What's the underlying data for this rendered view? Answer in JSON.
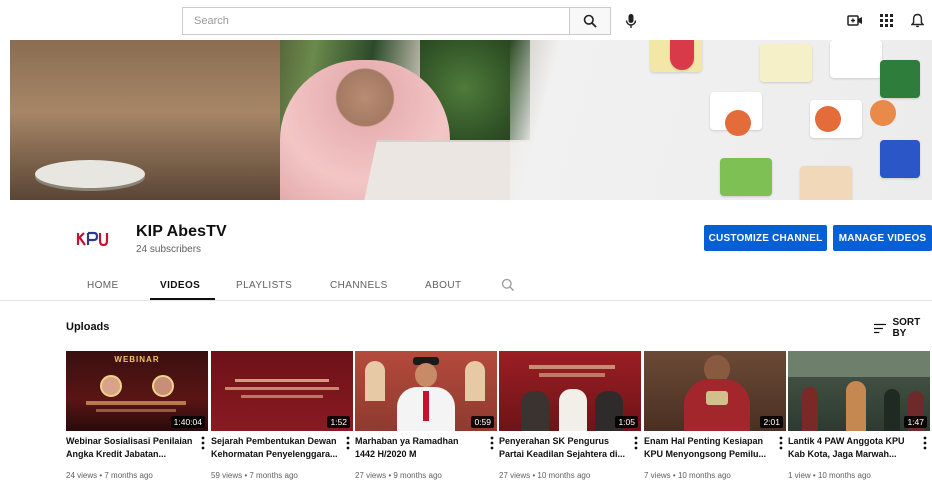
{
  "search": {
    "placeholder": "Search"
  },
  "channel": {
    "name": "KIP AbesTV",
    "subscribers": "24 subscribers",
    "logo_text": "KPU",
    "customize_label": "CUSTOMIZE CHANNEL",
    "manage_label": "MANAGE VIDEOS"
  },
  "tabs": [
    {
      "label": "HOME",
      "active": false
    },
    {
      "label": "VIDEOS",
      "active": true
    },
    {
      "label": "PLAYLISTS",
      "active": false
    },
    {
      "label": "CHANNELS",
      "active": false
    },
    {
      "label": "ABOUT",
      "active": false
    }
  ],
  "uploads": {
    "title": "Uploads",
    "sort_label": "SORT BY"
  },
  "videos": [
    {
      "title": "Webinar Sosialisasi Penilaian\nAngka Kredit Jabatan...",
      "views": "24 views",
      "age": "7 months ago",
      "duration": "1:40:04",
      "thumb_text": "WEBINAR"
    },
    {
      "title": "Sejarah Pembentukan Dewan\nKehormatan Penyelenggara...",
      "views": "59 views",
      "age": "7 months ago",
      "duration": "1:52",
      "thumb_text": ""
    },
    {
      "title": "Marhaban ya Ramadhan\n1442 H/2020 M",
      "views": "27 views",
      "age": "9 months ago",
      "duration": "0:59",
      "thumb_text": ""
    },
    {
      "title": "Penyerahan SK Pengurus\nPartai Keadilan Sejahtera di...",
      "views": "27 views",
      "age": "10 months ago",
      "duration": "1:05",
      "thumb_text": ""
    },
    {
      "title": "Enam Hal Penting Kesiapan\nKPU Menyongsong Pemilu...",
      "views": "7 views",
      "age": "10 months ago",
      "duration": "2:01",
      "thumb_text": ""
    },
    {
      "title": "Lantik 4 PAW Anggota KPU\nKab Kota, Jaga Marwah...",
      "views": "1 view",
      "age": "10 months ago",
      "duration": "1:47",
      "thumb_text": ""
    }
  ],
  "colors": {
    "accent": "#065fd4",
    "brand_red": "#c4122f",
    "text": "#0f0f0f",
    "muted": "#606060"
  }
}
